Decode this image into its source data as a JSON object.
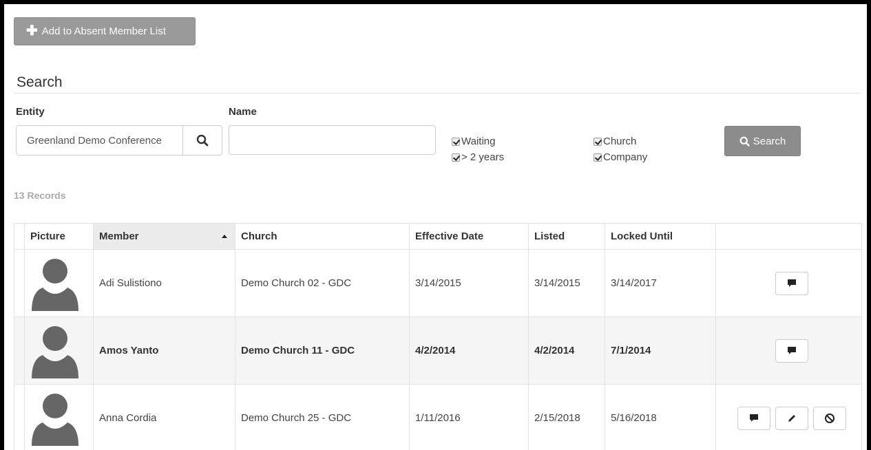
{
  "add_button": {
    "label": "Add to Absent Member List"
  },
  "search": {
    "title": "Search",
    "entity_label": "Entity",
    "entity_value": "Greenland Demo Conference",
    "name_label": "Name",
    "name_value": "",
    "checkboxes": [
      {
        "label": "Waiting",
        "checked": true
      },
      {
        "label": "> 2 years",
        "checked": true
      },
      {
        "label": "Church",
        "checked": true
      },
      {
        "label": "Company",
        "checked": true
      }
    ],
    "search_button_label": "Search"
  },
  "records_label": "13 Records",
  "table": {
    "columns": [
      "",
      "Picture",
      "Member",
      "Church",
      "Effective Date",
      "Listed",
      "Locked Until",
      ""
    ],
    "sorted_column": "Member",
    "sort_direction": "ascending",
    "rows": [
      {
        "member": "Adi Sulistiono",
        "church": "Demo Church 02 - GDC",
        "effective_date": "3/14/2015",
        "listed": "3/14/2015",
        "locked_until": "3/14/2017",
        "actions": [
          "comment-icon"
        ]
      },
      {
        "member": "Amos Yanto",
        "church": "Demo Church 11 - GDC",
        "effective_date": "4/2/2014",
        "listed": "4/2/2014",
        "locked_until": "7/1/2014",
        "actions": [
          "comment-icon"
        ]
      },
      {
        "member": "Anna Cordia",
        "church": "Demo Church 25 - GDC",
        "effective_date": "1/11/2016",
        "listed": "2/15/2018",
        "locked_until": "5/16/2018",
        "actions": [
          "comment-icon",
          "pencil-icon",
          "ban-icon"
        ]
      }
    ]
  },
  "colors": {
    "button_gray": "#9a9a9a",
    "search_button_gray": "#8c8c8c",
    "avatar_gray": "#666666"
  }
}
